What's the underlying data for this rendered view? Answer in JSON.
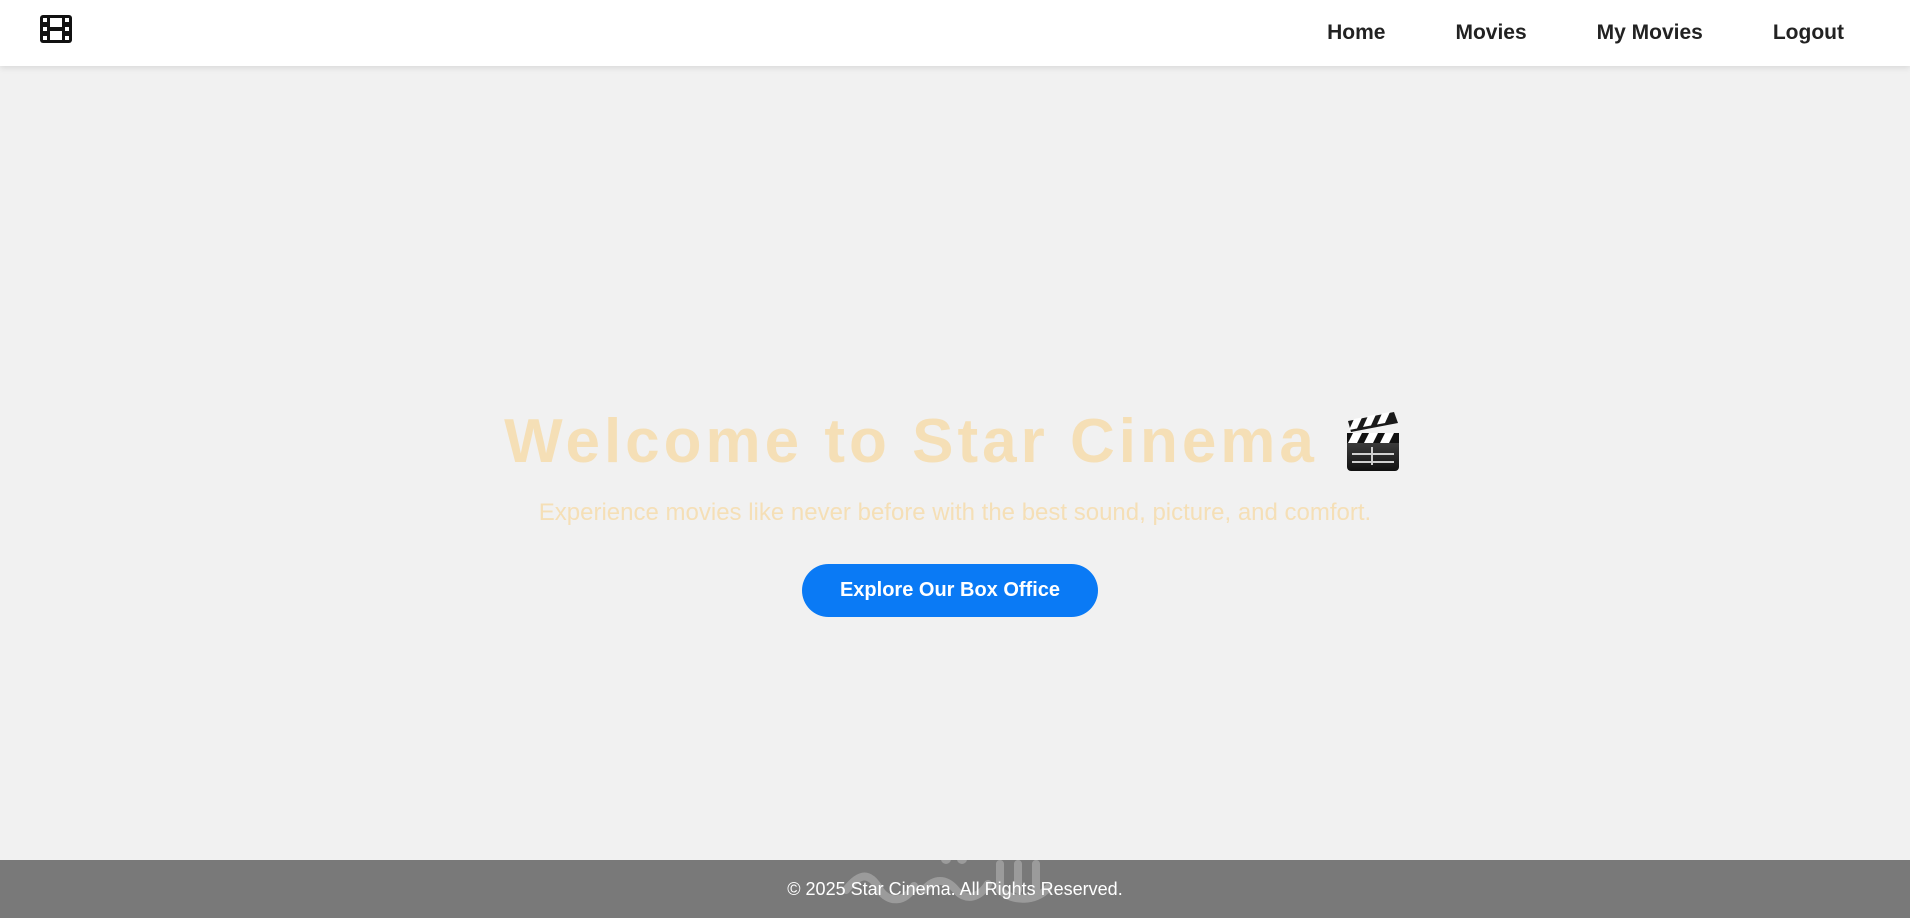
{
  "app": {
    "brand_icon": "film-strip-icon"
  },
  "nav": {
    "items": [
      {
        "label": "Home"
      },
      {
        "label": "Movies"
      },
      {
        "label": "My Movies"
      },
      {
        "label": "Logout"
      }
    ]
  },
  "hero": {
    "title": "Welcome to Star Cinema",
    "title_icon": "clapper-board-icon",
    "subtitle": "Experience movies like never before with the best sound, picture, and comfort.",
    "cta_label": "Explore Our Box Office"
  },
  "footer": {
    "copyright": "© 2025 Star Cinema. All Rights Reserved."
  },
  "colors": {
    "page_background": "#f1f1f1",
    "header_background": "#ffffff",
    "hero_text": "#f5dfb6",
    "cta_background": "#0a7af5",
    "footer_background": "#797979",
    "footer_text": "#ffffff"
  }
}
